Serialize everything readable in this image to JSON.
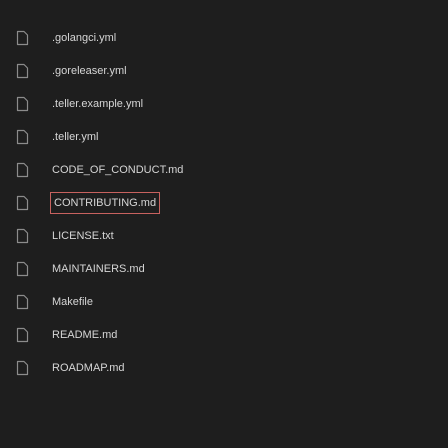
{
  "files": [
    {
      "name": ".golangci.yml"
    },
    {
      "name": ".goreleaser.yml"
    },
    {
      "name": ".teller.example.yml"
    },
    {
      "name": ".teller.yml"
    },
    {
      "name": "CODE_OF_CONDUCT.md"
    },
    {
      "name": "CONTRIBUTING.md",
      "selected": true
    },
    {
      "name": "LICENSE.txt"
    },
    {
      "name": "MAINTAINERS.md"
    },
    {
      "name": "Makefile"
    },
    {
      "name": "README.md"
    },
    {
      "name": "ROADMAP.md"
    }
  ],
  "icon": "file-icon",
  "colors": {
    "background": "#1e1e1e",
    "text": "#d6d6d6",
    "icon_stroke": "#8c8c8c",
    "selection_border": "#c8625f"
  }
}
